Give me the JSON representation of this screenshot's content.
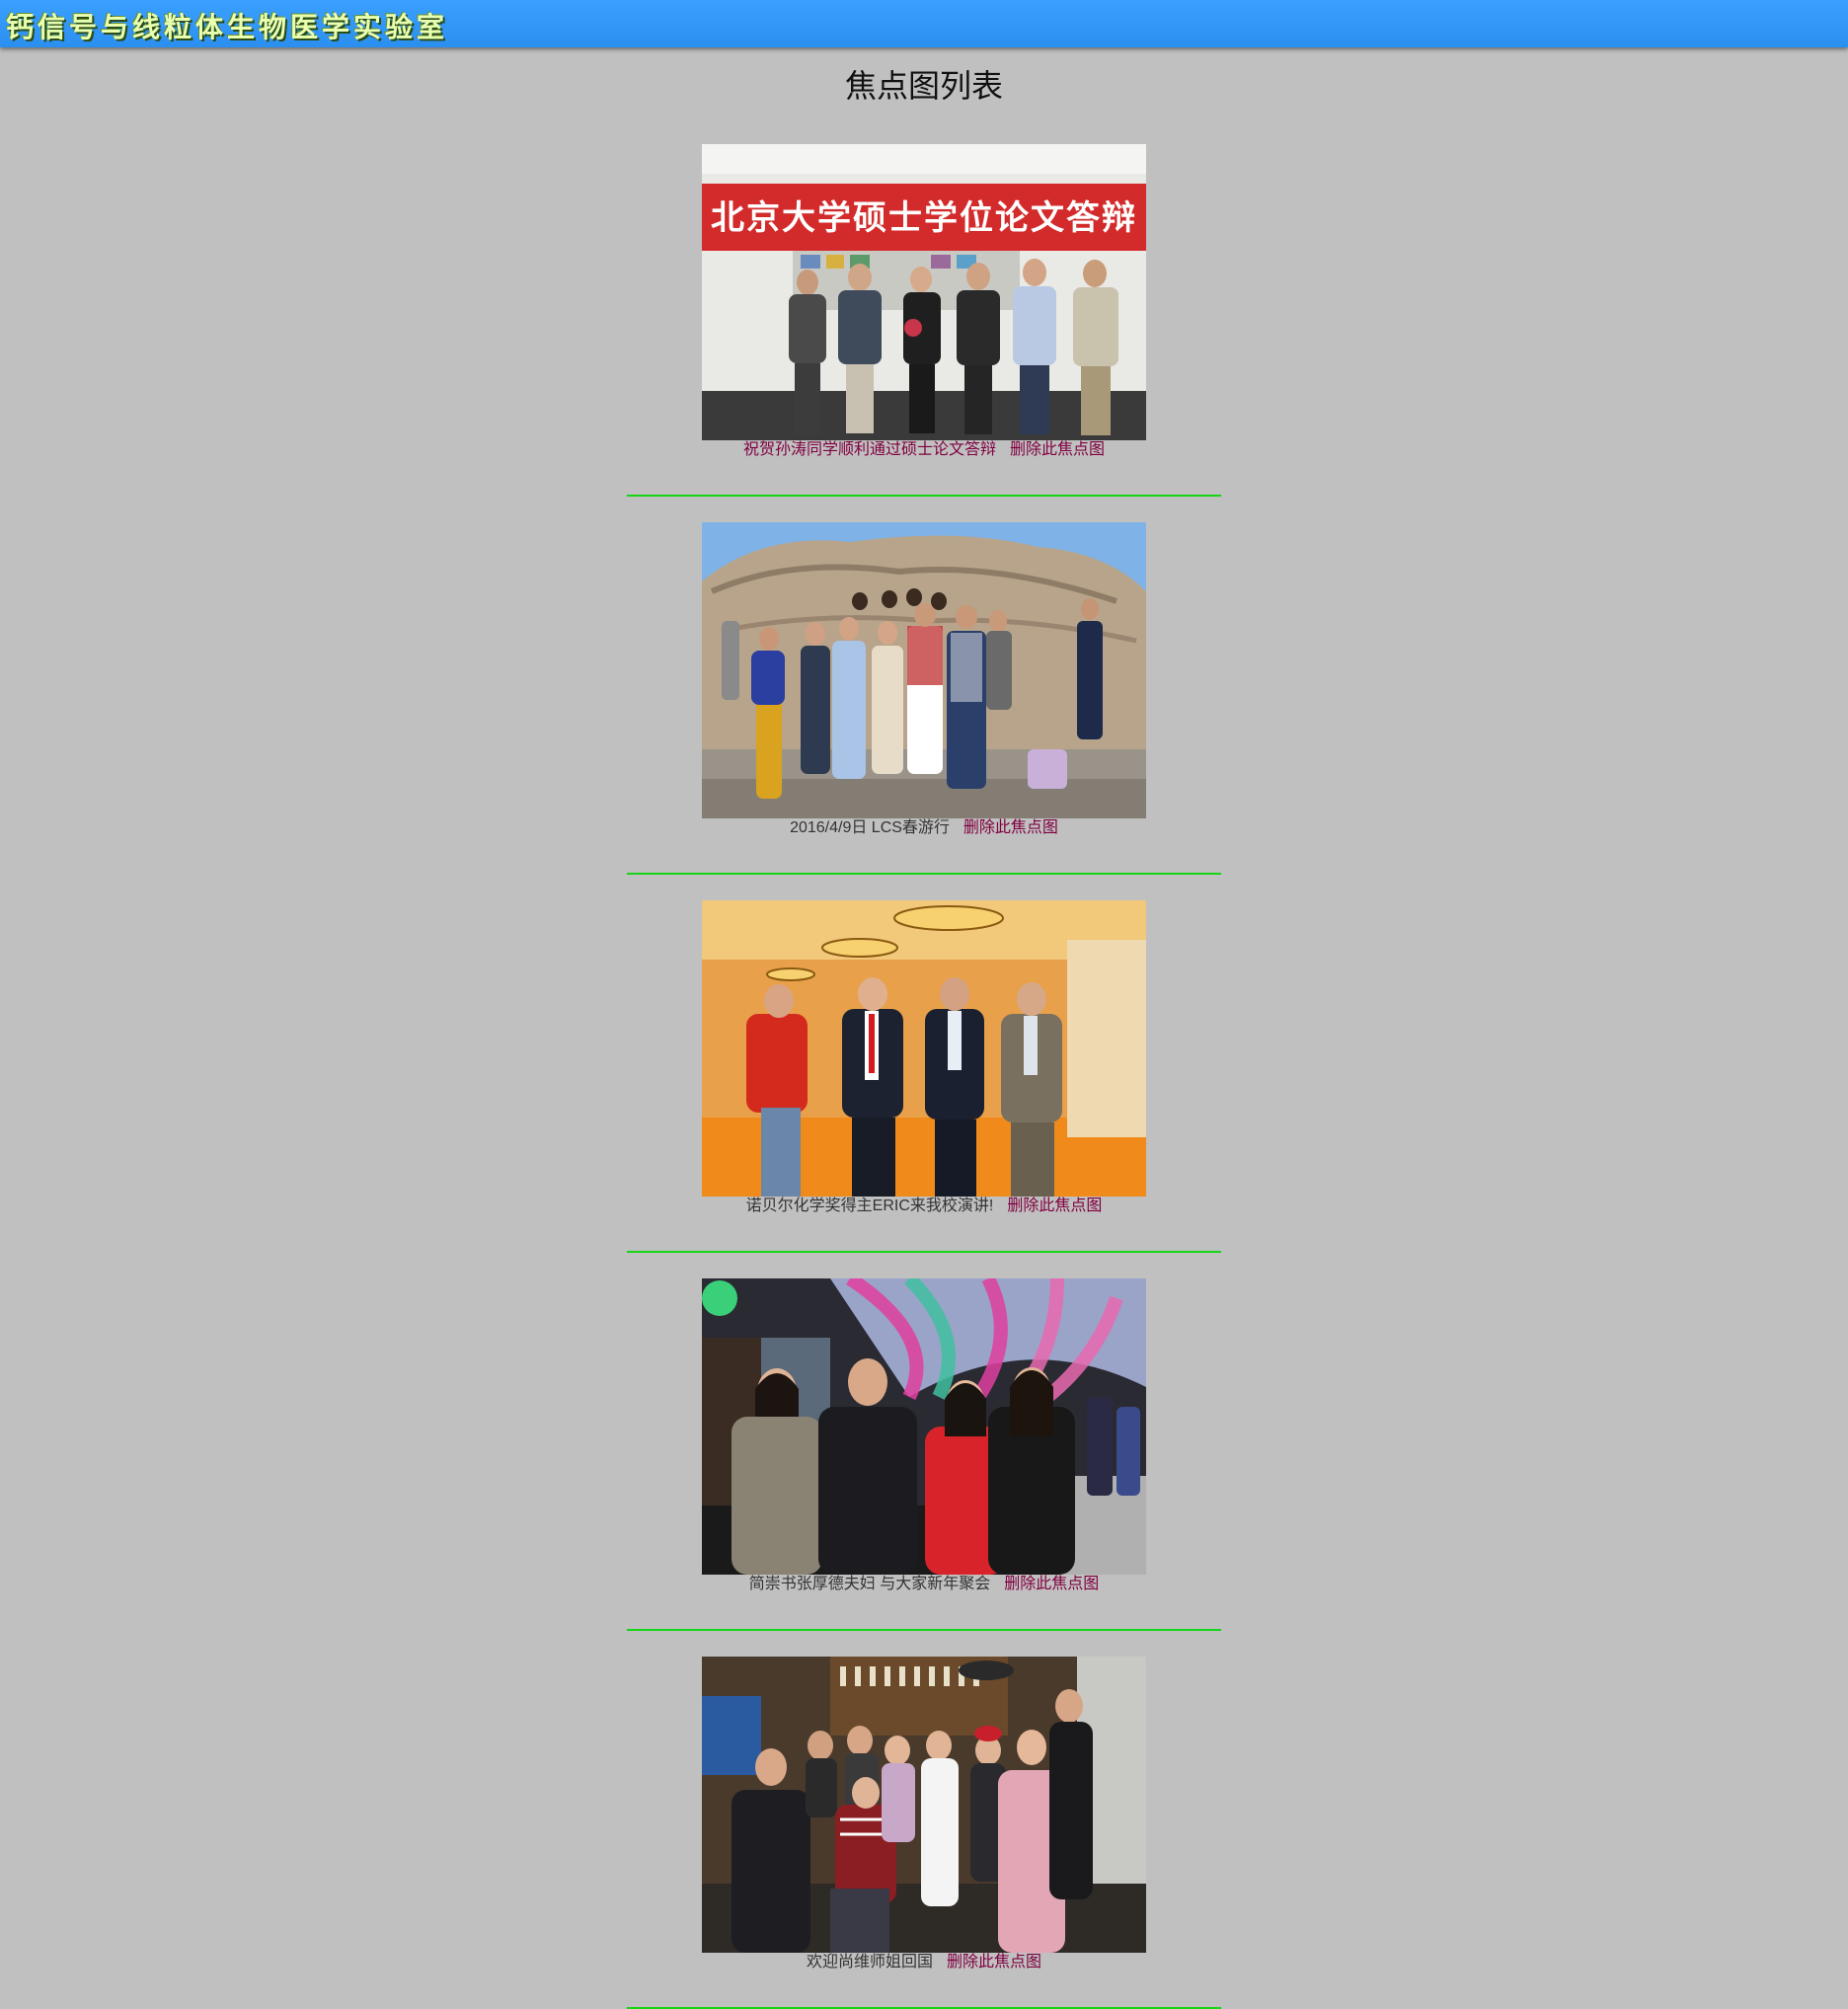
{
  "header": {
    "logo_text": "钙信号与线粒体生物医学实验室"
  },
  "page": {
    "title": "焦点图列表"
  },
  "focus_items": [
    {
      "banner_text": "北京大学硕士学位论文答辩",
      "caption": "祝贺孙涛同学顺利通过硕士论文答辩",
      "delete_label": "删除此焦点图"
    },
    {
      "caption": "2016/4/9日 LCS春游行",
      "delete_label": "删除此焦点图"
    },
    {
      "caption": "诺贝尔化学奖得主ERIC来我校演讲!",
      "delete_label": "删除此焦点图"
    },
    {
      "caption": "简崇书张厚德夫妇 与大家新年聚会",
      "delete_label": "删除此焦点图"
    },
    {
      "caption": "欢迎尚维师姐回国",
      "delete_label": "删除此焦点图"
    }
  ],
  "colors": {
    "header_blue": "#3399ff",
    "page_background": "#c0c0c0",
    "divider_green": "#16d416",
    "link_maroon": "#800040"
  }
}
